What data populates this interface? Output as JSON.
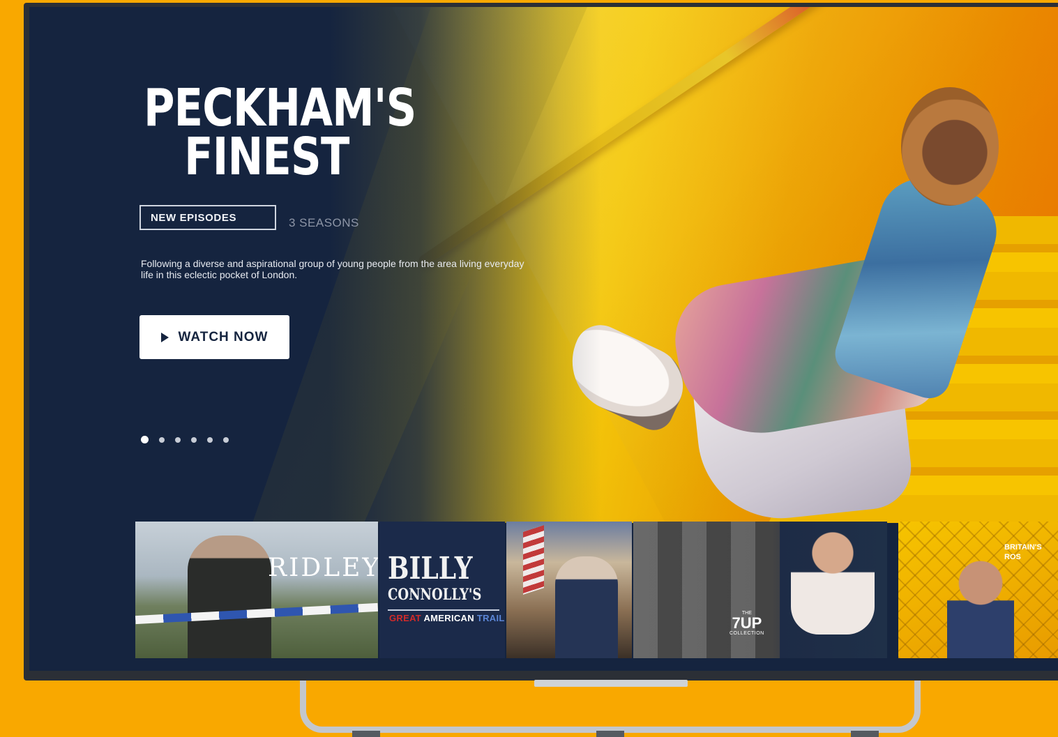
{
  "hero": {
    "title_line1": "PECKHAM'S",
    "title_line2": "FINEST",
    "tag": "NEW EPISODES",
    "seasons": "3 SEASONS",
    "description": "Following a diverse and aspirational group of young people from the area living everyday life in this eclectic pocket of London.",
    "watch_label": "WATCH NOW",
    "carousel": {
      "count": 6,
      "active_index": 0
    }
  },
  "tiles": [
    {
      "title": "RIDLEY"
    },
    {
      "title_line1": "BILLY",
      "title_line2": "CONNOLLY'S",
      "title_line3_a": "GREAT",
      "title_line3_b": "AMERICAN",
      "title_line3_c": "TRAIL"
    },
    {
      "title": ""
    },
    {
      "label_the": "THE",
      "label_main": "7UP",
      "label_col": "COLLECTION"
    },
    {
      "title_line1": "BRITAIN'S",
      "title_line2": "ROS"
    }
  ],
  "colors": {
    "background": "#F9A800",
    "hero_panel": "#15243f",
    "button_bg": "#ffffff"
  }
}
